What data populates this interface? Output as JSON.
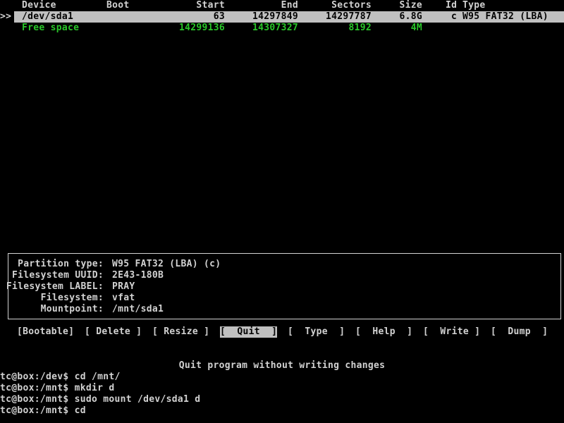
{
  "table": {
    "columns": {
      "device": "Device",
      "boot": "Boot",
      "start": "Start",
      "end": "End",
      "sectors": "Sectors",
      "size": "Size",
      "id": "Id",
      "type": "Type"
    },
    "selector": ">>",
    "rows": [
      {
        "device": "/dev/sda1",
        "boot": "",
        "start": "63",
        "end": "14297849",
        "sectors": "14297787",
        "size": "6.8G",
        "id": "c",
        "type": "W95 FAT32 (LBA)"
      },
      {
        "device": "Free space",
        "boot": "",
        "start": "14299136",
        "end": "14307327",
        "sectors": "8192",
        "size": "4M",
        "id": "",
        "type": ""
      }
    ]
  },
  "info": [
    {
      "label": "Partition type:",
      "value": "W95 FAT32 (LBA) (c)"
    },
    {
      "label": "Filesystem UUID:",
      "value": "2E43-180B"
    },
    {
      "label": "Filesystem LABEL:",
      "value": "PRAY"
    },
    {
      "label": "Filesystem:",
      "value": "vfat"
    },
    {
      "label": "Mountpoint:",
      "value": "/mnt/sda1"
    }
  ],
  "menu": [
    {
      "label": "[Bootable]",
      "active": false
    },
    {
      "label": "[ Delete ]",
      "active": false
    },
    {
      "label": "[ Resize ]",
      "active": false
    },
    {
      "label": "[  Quit  ]",
      "active": true
    },
    {
      "label": "[  Type  ]",
      "active": false
    },
    {
      "label": "[  Help  ]",
      "active": false
    },
    {
      "label": "[  Write ]",
      "active": false
    },
    {
      "label": "[  Dump  ]",
      "active": false
    }
  ],
  "hint": "Quit program without writing changes",
  "shell": [
    "tc@box:/dev$ cd /mnt/",
    "tc@box:/mnt$ mkdir d",
    "tc@box:/mnt$ sudo mount /dev/sda1 d",
    "tc@box:/mnt$ cd"
  ],
  "colors": {
    "background": "#000000",
    "text": "#d2d2d2",
    "selection": "#c0c0c0",
    "free_space": "#29c629"
  }
}
